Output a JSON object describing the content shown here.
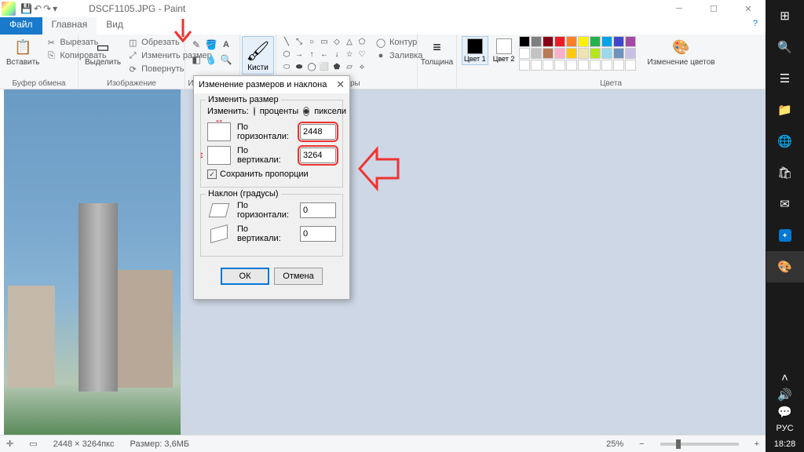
{
  "window": {
    "title": "DSCF1105.JPG - Paint"
  },
  "tabs": {
    "file": "Файл",
    "home": "Главная",
    "view": "Вид"
  },
  "ribbon": {
    "clipboard": {
      "label": "Буфер обмена",
      "paste": "Вставить",
      "cut": "Вырезать",
      "copy": "Копировать"
    },
    "image": {
      "label": "Изображение",
      "select": "Выделить",
      "crop": "Обрезать",
      "resize": "Изменить размер",
      "rotate": "Повернуть"
    },
    "tools": {
      "label": "Инструменты"
    },
    "brushes": {
      "label": "Кисти"
    },
    "shapes": {
      "label": "Фигуры",
      "outline": "Контур",
      "fill": "Заливка"
    },
    "size": {
      "label": "Толщина"
    },
    "colors": {
      "label": "Цвета",
      "c1": "Цвет 1",
      "c2": "Цвет 2",
      "edit": "Изменение цветов"
    }
  },
  "dialog": {
    "title": "Изменение размеров и наклона",
    "resize": {
      "legend": "Изменить размер",
      "by_label": "Изменить:",
      "percent": "проценты",
      "pixels": "пиксели",
      "horiz": "По горизонтали:",
      "vert": "По вертикали:",
      "h_val": "2448",
      "v_val": "3264",
      "aspect": "Сохранить пропорции"
    },
    "skew": {
      "legend": "Наклон (градусы)",
      "horiz": "По горизонтали:",
      "vert": "По вертикали:",
      "h_val": "0",
      "v_val": "0"
    },
    "ok": "ОК",
    "cancel": "Отмена"
  },
  "status": {
    "dims": "2448 × 3264пкс",
    "size_label": "Размер: 3,6МБ",
    "zoom": "25%"
  },
  "taskbar": {
    "lang": "РУС",
    "time": "18:28"
  },
  "palette_colors": [
    "#000",
    "#7f7f7f",
    "#880015",
    "#ed1c24",
    "#ff7f27",
    "#fff200",
    "#22b14c",
    "#00a2e8",
    "#3f48cc",
    "#a349a4",
    "#fff",
    "#c3c3c3",
    "#b97a57",
    "#ffaec9",
    "#ffc90e",
    "#efe4b0",
    "#b5e61d",
    "#99d9ea",
    "#7092be",
    "#c8bfe7",
    "#fff",
    "#fff",
    "#fff",
    "#fff",
    "#fff",
    "#fff",
    "#fff",
    "#fff",
    "#fff",
    "#fff"
  ]
}
